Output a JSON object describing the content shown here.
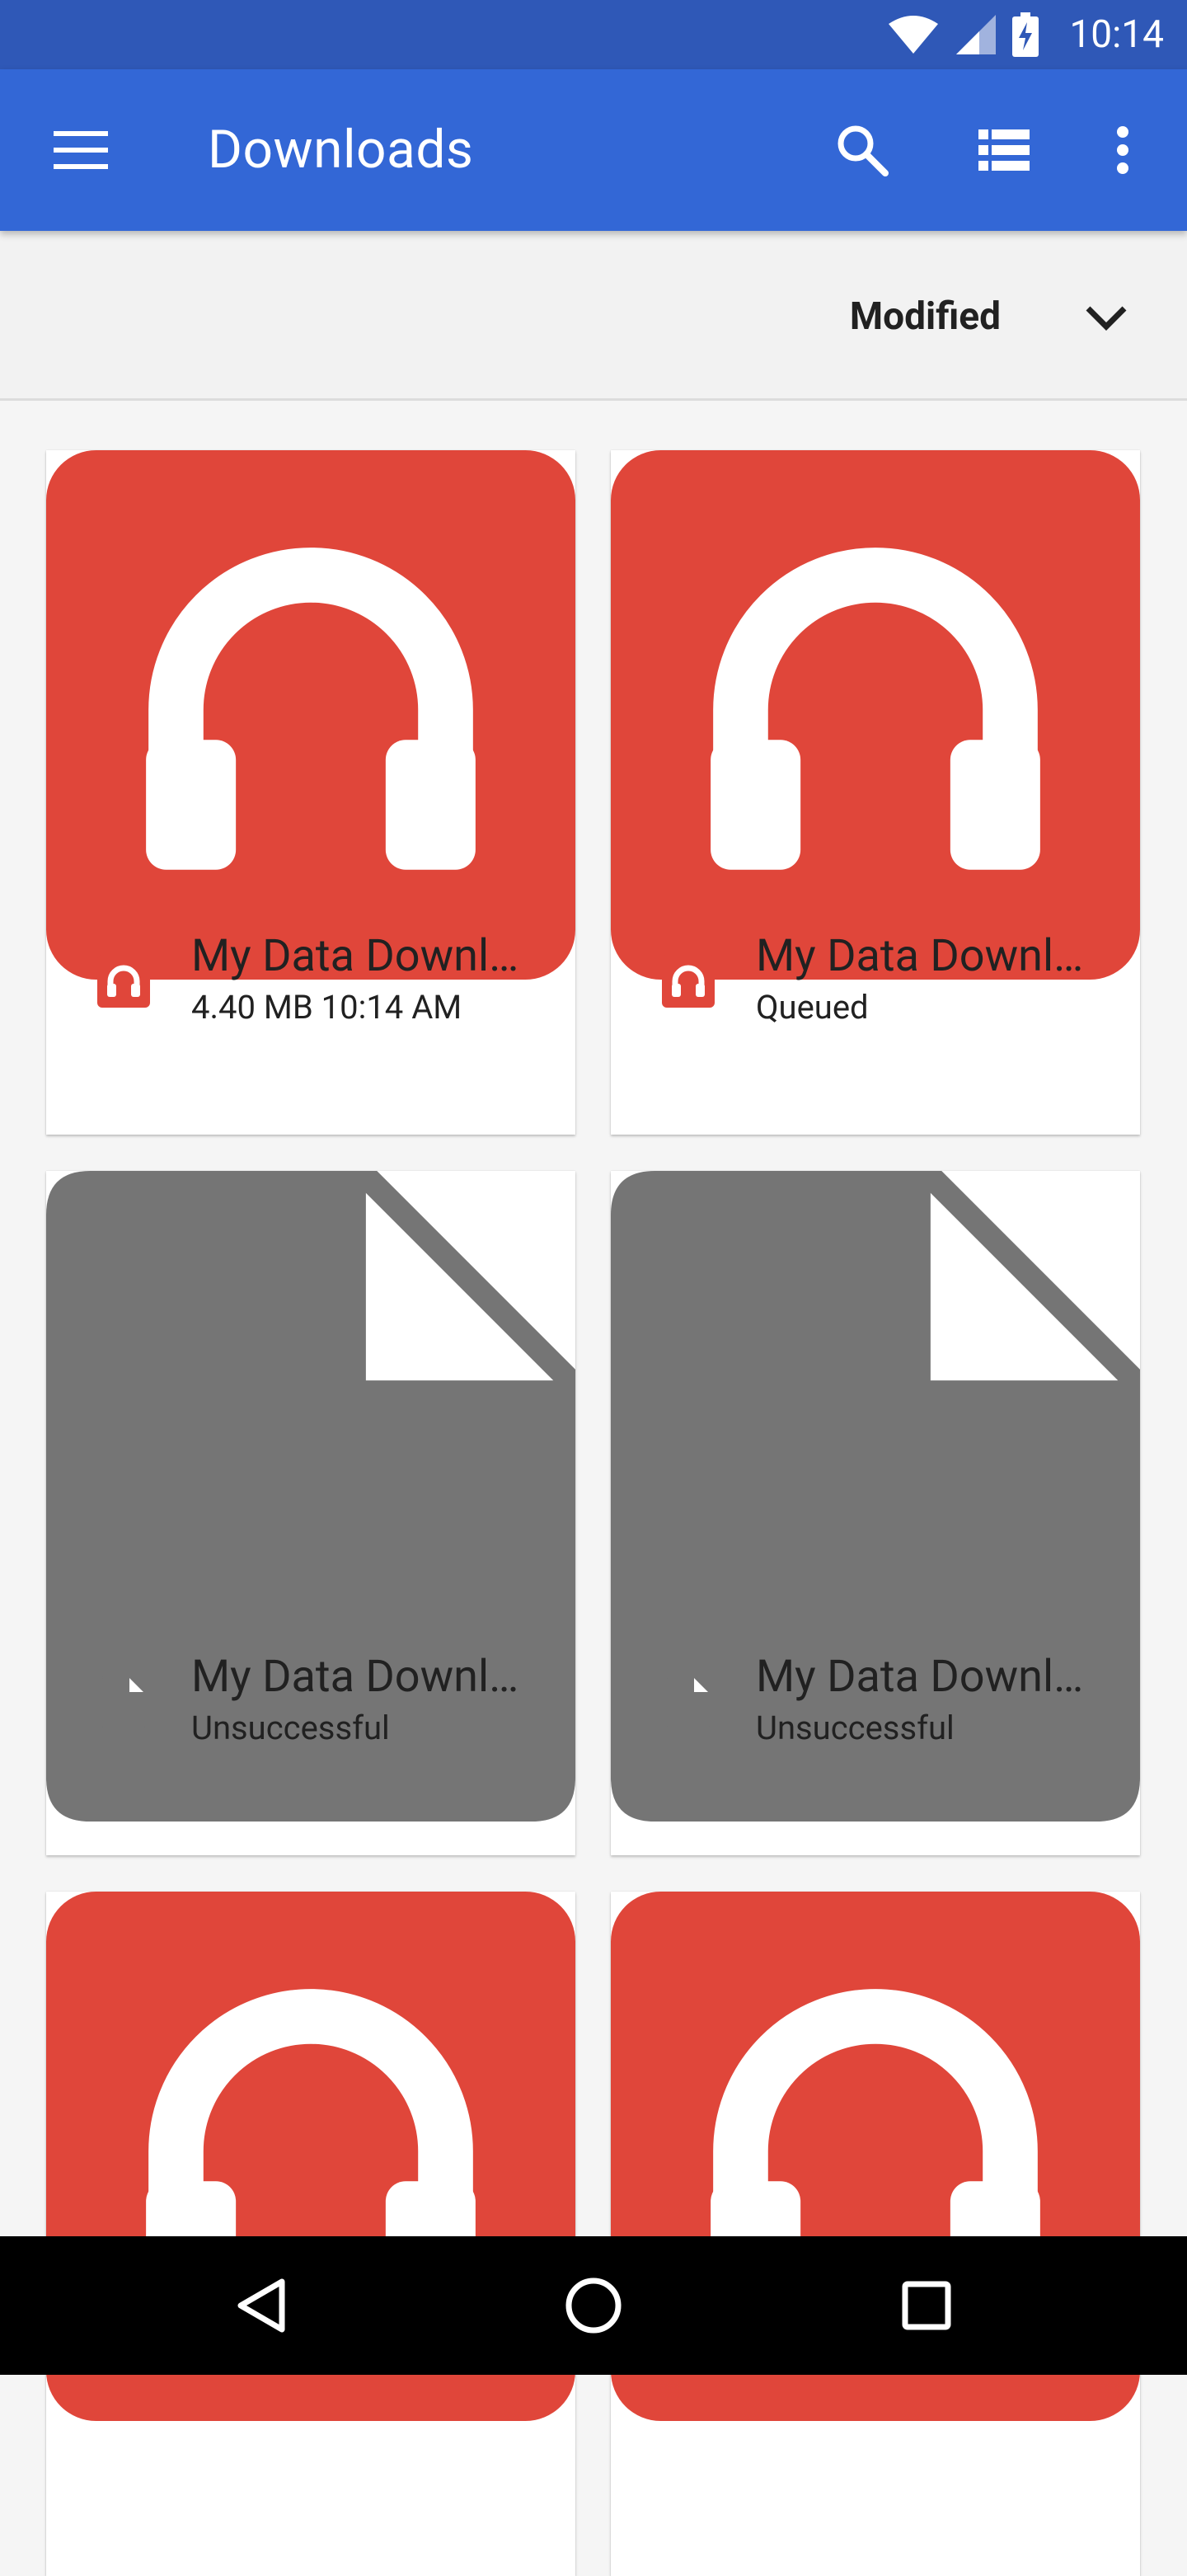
{
  "status_bar": {
    "time": "10:14",
    "icons": [
      "wifi-icon",
      "signal-icon",
      "battery-charging-icon"
    ]
  },
  "app_bar": {
    "title": "Downloads",
    "actions": [
      "menu-icon",
      "search-icon",
      "list-view-icon",
      "more-vert-icon"
    ]
  },
  "sort_bar": {
    "label": "Modified"
  },
  "items": [
    {
      "name": "My Data Downl…",
      "meta": "4.40 MB 10:14 AM",
      "type": "audio"
    },
    {
      "name": "My Data Downl…",
      "meta": "Queued",
      "type": "audio"
    },
    {
      "name": "My Data Downl…",
      "meta": "Unsuccessful",
      "type": "file"
    },
    {
      "name": "My Data Downl…",
      "meta": "Unsuccessful",
      "type": "file"
    },
    {
      "type": "audio"
    },
    {
      "type": "audio"
    }
  ],
  "colors": {
    "app_bar": "#3367d6",
    "status_bar": "#2f58b7",
    "audio_icon": "#e0463a",
    "file_icon": "#757575"
  },
  "nav_bar": {
    "buttons": [
      "back-icon",
      "home-icon",
      "recents-icon"
    ]
  }
}
